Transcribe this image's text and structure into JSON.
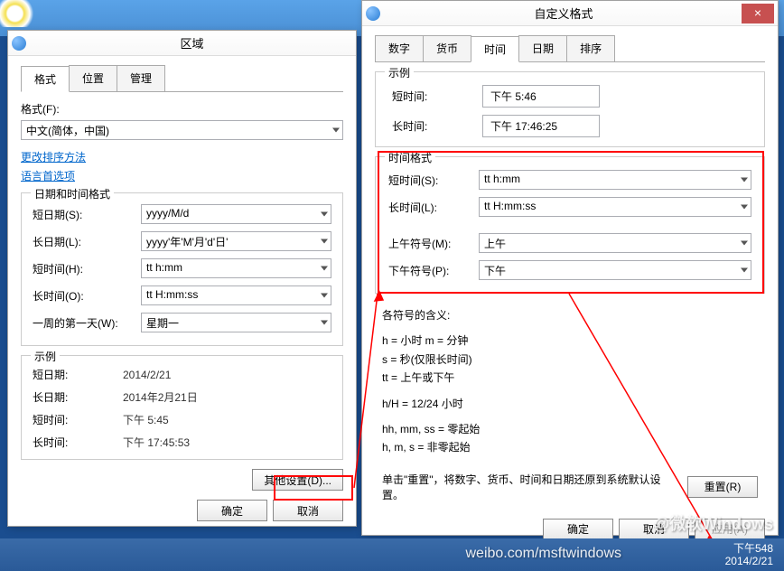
{
  "region_window": {
    "title": "区域",
    "tabs": [
      "格式",
      "位置",
      "管理"
    ],
    "format_label": "格式(F):",
    "format_value": "中文(简体，中国)",
    "link_sort": "更改排序方法",
    "link_lang": "语言首选项",
    "datetime_group": "日期和时间格式",
    "rows": [
      {
        "label": "短日期(S):",
        "value": "yyyy/M/d"
      },
      {
        "label": "长日期(L):",
        "value": "yyyy'年'M'月'd'日'"
      },
      {
        "label": "短时间(H):",
        "value": "tt h:mm"
      },
      {
        "label": "长时间(O):",
        "value": "tt H:mm:ss"
      },
      {
        "label": "一周的第一天(W):",
        "value": "星期一"
      }
    ],
    "sample_group": "示例",
    "samples": [
      {
        "label": "短日期:",
        "value": "2014/2/21"
      },
      {
        "label": "长日期:",
        "value": "2014年2月21日"
      },
      {
        "label": "短时间:",
        "value": "下午 5:45"
      },
      {
        "label": "长时间:",
        "value": "下午 17:45:53"
      }
    ],
    "other_settings": "其他设置(D)...",
    "ok": "确定",
    "cancel": "取消"
  },
  "custom_window": {
    "title": "自定义格式",
    "close": "×",
    "tabs": [
      "数字",
      "货币",
      "时间",
      "日期",
      "排序"
    ],
    "sample_group": "示例",
    "samples": [
      {
        "label": "短时间:",
        "value": "下午 5:46"
      },
      {
        "label": "长时间:",
        "value": "下午 17:46:25"
      }
    ],
    "format_group": "时间格式",
    "rows": [
      {
        "label": "短时间(S):",
        "value": "tt h:mm"
      },
      {
        "label": "长时间(L):",
        "value": "tt H:mm:ss"
      },
      {
        "label": "上午符号(M):",
        "value": "上午"
      },
      {
        "label": "下午符号(P):",
        "value": "下午"
      }
    ],
    "legend_title": "各符号的含义:",
    "legend_1": "h = 小时    m = 分钟",
    "legend_2": "s = 秒(仅限长时间)",
    "legend_3": "tt = 上午或下午",
    "legend_4": "h/H = 12/24 小时",
    "legend_5": "hh, mm, ss = 零起始",
    "legend_6": "h, m, s = 非零起始",
    "reset_note": "单击\"重置\"，将数字、货币、时间和日期还原到系统默认设置。",
    "reset": "重置(R)",
    "ok": "确定",
    "cancel": "取消",
    "apply": "应用(A)"
  },
  "watermark": "@微软Windows",
  "watermark2": "weibo.com/msftwindows",
  "taskbar": {
    "time": "下午548",
    "date": "2014/2/21"
  }
}
